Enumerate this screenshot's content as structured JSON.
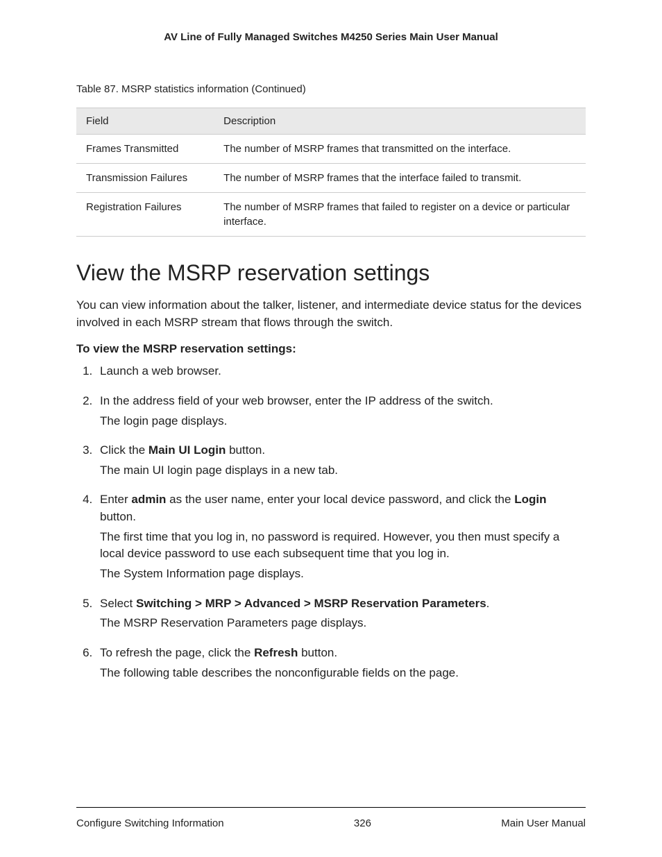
{
  "header": "AV Line of Fully Managed Switches M4250 Series Main User Manual",
  "table_caption": "Table 87. MSRP statistics information (Continued)",
  "table": {
    "head_field": "Field",
    "head_desc": "Description",
    "rows": [
      {
        "field": "Frames Transmitted",
        "desc": "The number of MSRP frames that transmitted on the interface."
      },
      {
        "field": "Transmission Failures",
        "desc": "The number of MSRP frames that the interface failed to transmit."
      },
      {
        "field": "Registration Failures",
        "desc": "The number of MSRP frames that failed to register on a device or particular interface."
      }
    ]
  },
  "section_heading": "View the MSRP reservation settings",
  "intro": "You can view information about the talker, listener, and intermediate device status for the devices involved in each MSRP stream that flows through the switch.",
  "subhead": "To view the MSRP reservation settings:",
  "steps": {
    "s1": "Launch a web browser.",
    "s2a": "In the address field of your web browser, enter the IP address of the switch.",
    "s2b": "The login page displays.",
    "s3a_pre": "Click the ",
    "s3a_bold": "Main UI Login",
    "s3a_post": " button.",
    "s3b": "The main UI login page displays in a new tab.",
    "s4a_pre": "Enter ",
    "s4a_bold1": "admin",
    "s4a_mid": " as the user name, enter your local device password, and click the ",
    "s4a_bold2": "Login",
    "s4a_post": " button.",
    "s4b": "The first time that you log in, no password is required. However, you then must specify a local device password to use each subsequent time that you log in.",
    "s4c": "The System Information page displays.",
    "s5a_pre": "Select ",
    "s5a_bold": "Switching > MRP > Advanced > MSRP Reservation Parameters",
    "s5a_post": ".",
    "s5b": "The MSRP Reservation Parameters page displays.",
    "s6a_pre": "To refresh the page, click the ",
    "s6a_bold": "Refresh",
    "s6a_post": " button.",
    "s6b": "The following table describes the nonconfigurable fields on the page."
  },
  "footer": {
    "left": "Configure Switching Information",
    "center": "326",
    "right": "Main User Manual"
  }
}
